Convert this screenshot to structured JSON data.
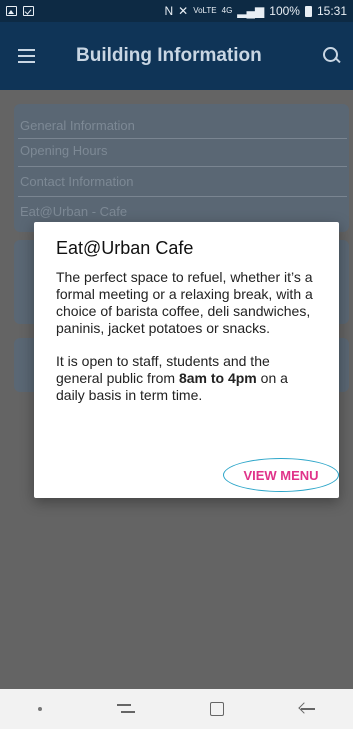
{
  "status_bar": {
    "lte_label": "VoLTE",
    "net_label": "4G",
    "battery": "100%",
    "time": "15:31"
  },
  "app_bar": {
    "title": "Building Information"
  },
  "background_list": {
    "items": [
      "General Information",
      "Opening Hours",
      "Contact Information",
      "Eat@Urban - Cafe"
    ]
  },
  "dialog": {
    "title": "Eat@Urban Cafe",
    "paragraph1": "The perfect space to refuel, whether it’s a formal meeting or a relaxing break, with a choice of barista coffee, deli sandwiches, paninis, jacket potatoes or snacks.",
    "paragraph2_prefix": "It is open to staff, students and the general public from ",
    "paragraph2_hours": "8am to 4pm",
    "paragraph2_suffix": " on a daily basis in term time.",
    "button_label": "VIEW MENU"
  },
  "colors": {
    "app_bar": "#0f3457",
    "button_text": "#e0338a",
    "button_outline": "#2da6c9"
  }
}
